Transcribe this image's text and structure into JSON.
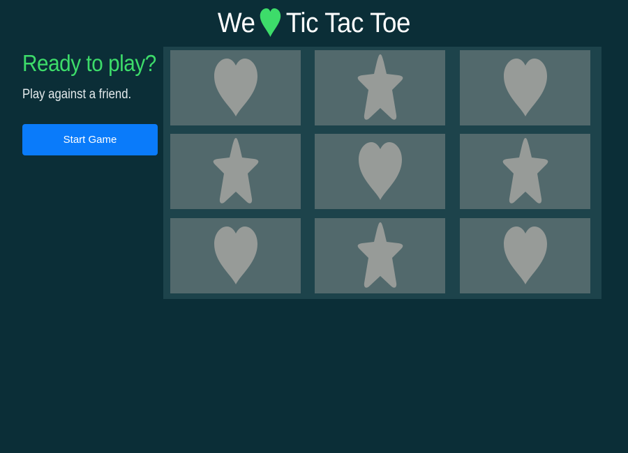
{
  "header": {
    "title_before": "We",
    "title_icon": "heart-icon",
    "title_after": "Tic Tac Toe",
    "heart_color": "#3ddc6a"
  },
  "sidebar": {
    "heading": "Ready to play?",
    "subtext": "Play against a friend.",
    "start_label": "Start Game"
  },
  "board": {
    "cells": [
      "heart",
      "star",
      "heart",
      "star",
      "heart",
      "star",
      "heart",
      "star",
      "heart"
    ],
    "piece_color": "#979b98"
  },
  "colors": {
    "background": "#0b2e37",
    "board": "#1d434b",
    "cell": "#52696c",
    "accent": "#3ddc6a",
    "button": "#0a7bfa"
  }
}
